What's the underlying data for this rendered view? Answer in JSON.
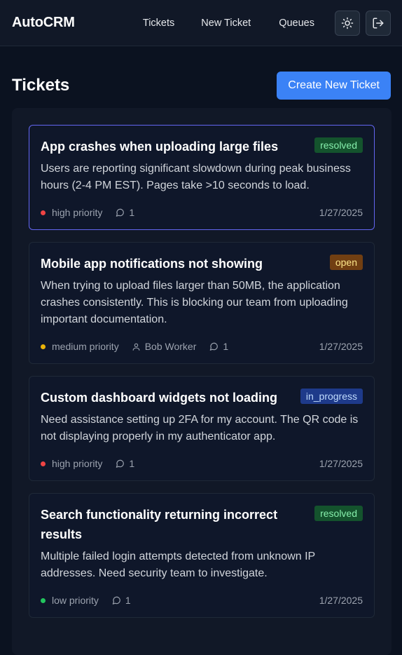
{
  "app": {
    "brand": "AutoCRM"
  },
  "nav": {
    "tickets": "Tickets",
    "new_ticket": "New Ticket",
    "queues": "Queues"
  },
  "page": {
    "title": "Tickets",
    "create_button": "Create New Ticket"
  },
  "colors": {
    "accent": "#3b82f6",
    "priority_high": "#ef4444",
    "priority_medium": "#eab308",
    "priority_low": "#22c55e"
  },
  "tickets": [
    {
      "title": "App crashes when uploading large files",
      "status": "resolved",
      "description": "Users are reporting significant slowdown during peak business hours (2-4 PM EST). Pages take >10 seconds to load.",
      "priority": "high priority",
      "assignee": "",
      "comments": "1",
      "date": "1/27/2025"
    },
    {
      "title": "Mobile app notifications not showing",
      "status": "open",
      "description": "When trying to upload files larger than 50MB, the application crashes consistently. This is blocking our team from uploading important documentation.",
      "priority": "medium priority",
      "assignee": "Bob Worker",
      "comments": "1",
      "date": "1/27/2025"
    },
    {
      "title": "Custom dashboard widgets not loading",
      "status": "in_progress",
      "description": "Need assistance setting up 2FA for my account. The QR code is not displaying properly in my authenticator app.",
      "priority": "high priority",
      "assignee": "",
      "comments": "1",
      "date": "1/27/2025"
    },
    {
      "title": "Search functionality returning incorrect results",
      "status": "resolved",
      "description": "Multiple failed login attempts detected from unknown IP addresses. Need security team to investigate.",
      "priority": "low priority",
      "assignee": "",
      "comments": "1",
      "date": "1/27/2025"
    }
  ]
}
